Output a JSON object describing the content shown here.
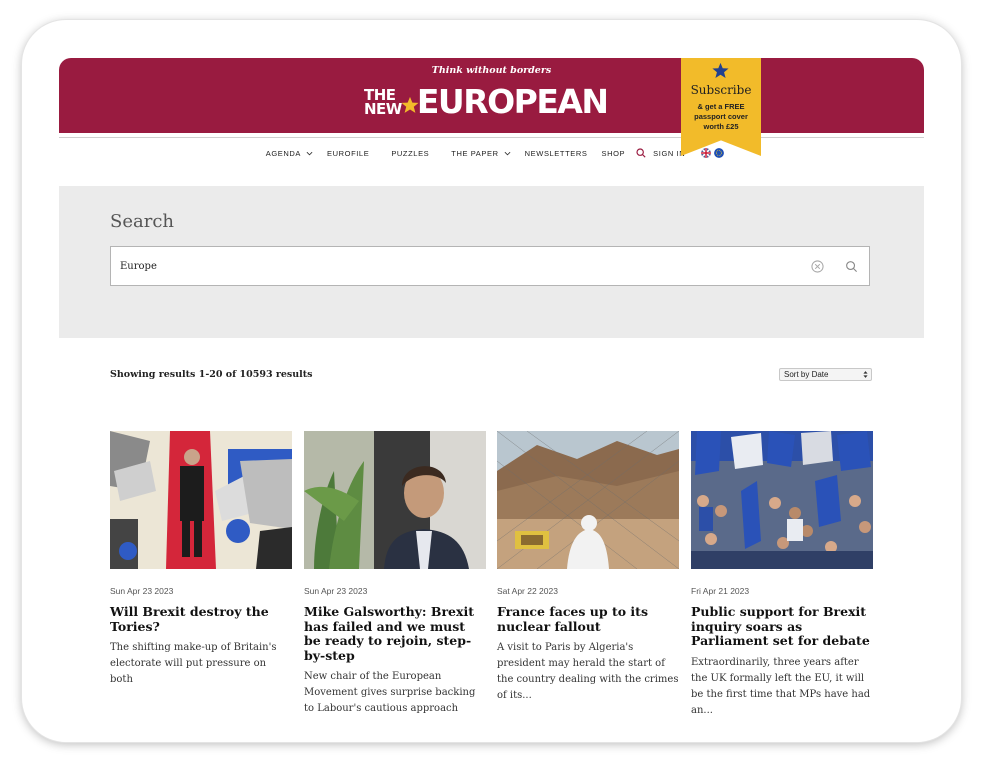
{
  "header": {
    "tagline": "Think without borders",
    "logo_the": "THE",
    "logo_new": "NEW",
    "logo_main": "EUROPEAN",
    "brand_color": "#991b40",
    "subscribe": {
      "title": "Subscribe",
      "line1": "& get a FREE",
      "line2": "passport cover",
      "line3": "worth £25",
      "color": "#f2bb2a"
    }
  },
  "nav": {
    "items": [
      "AGENDA",
      "EUROFILE",
      "PUZZLES",
      "THE PAPER",
      "NEWSLETTERS",
      "SHOP"
    ],
    "sign_in": "SIGN IN"
  },
  "search": {
    "title": "Search",
    "query": "Europe"
  },
  "results": {
    "count_text": "Showing results 1-20 of 10593 results",
    "sort_label": "Sort by Date"
  },
  "articles": [
    {
      "date": "Sun Apr 23 2023",
      "title": "Will Brexit destroy the Tories?",
      "summary": "The shifting make-up of Britain's electorate will put pressure on both"
    },
    {
      "date": "Sun Apr 23 2023",
      "title": "Mike Galsworthy: Brexit has failed and we must be ready to rejoin, step-by-step",
      "summary": "New chair of the European Movement gives surprise backing to Labour's cautious approach"
    },
    {
      "date": "Sat Apr 22 2023",
      "title": "France faces up to its nuclear fallout",
      "summary": "A visit to Paris by Algeria's president may herald the start of the country dealing with the crimes of its..."
    },
    {
      "date": "Fri Apr 21 2023",
      "title": "Public support for Brexit inquiry soars as Parliament set for debate",
      "summary": "Extraordinarily, three years after the UK formally left the EU, it will be the first time that MPs have had an..."
    }
  ]
}
